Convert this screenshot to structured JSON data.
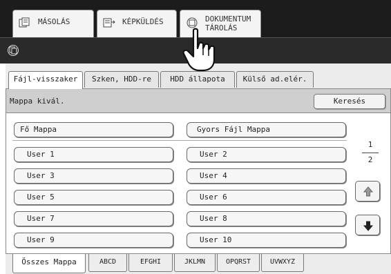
{
  "mode_tabs": [
    {
      "label": "MÁSOLÁS",
      "icon": "copy-icon"
    },
    {
      "label": "KÉPKÜLDÉS",
      "icon": "image-send-icon"
    },
    {
      "label_line1": "DOKUMENTUM",
      "label_line2": "TÁROLÁS",
      "icon": "document-filing-icon"
    }
  ],
  "toolbar": {
    "icon": "document-filing-icon"
  },
  "sub_tabs": [
    "Fájl-visszaker",
    "Szken, HDD-re",
    "HDD állapota",
    "Külső ad.elér."
  ],
  "header": {
    "title": "Mappa kivál.",
    "search_label": "Keresés"
  },
  "folders": [
    "Fő Mappa",
    "Gyors Fájl Mappa",
    "User 1",
    "User 2",
    "User 3",
    "User 4",
    "User 5",
    "User 6",
    "User 7",
    "User 8",
    "User 9",
    "User 10"
  ],
  "pagination": {
    "current": "1",
    "total": "2"
  },
  "filter_tabs": [
    "Összes Mappa",
    "ABCD",
    "EFGHI",
    "JKLMN",
    "OPQRST",
    "UVWXYZ"
  ],
  "colors": {
    "top_bar": "#1c1c1c",
    "panel": "#ececec",
    "header_bar": "#cfcfcf"
  }
}
